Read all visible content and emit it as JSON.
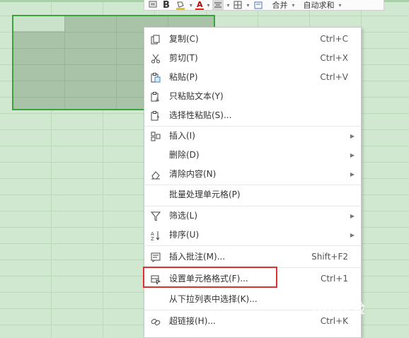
{
  "toolbar": {
    "bold": "B",
    "font_color": "A",
    "merge": "合并",
    "autosum": "自动求和",
    "highlight_color": "#e8c21a",
    "font_color_hex": "#e21e1e"
  },
  "menu": {
    "items": [
      {
        "label": "复制(C)",
        "shortcut": "Ctrl+C",
        "icon": "copy-icon"
      },
      {
        "label": "剪切(T)",
        "shortcut": "Ctrl+X",
        "icon": "scissors-icon"
      },
      {
        "label": "粘贴(P)",
        "shortcut": "Ctrl+V",
        "icon": "paste-icon"
      },
      {
        "label": "只粘贴文本(Y)",
        "icon": "paste-text-icon"
      },
      {
        "label": "选择性粘贴(S)...",
        "icon": "paste-special-icon"
      },
      {
        "label": "插入(I)",
        "icon": "insert-icon",
        "submenu": true
      },
      {
        "label": "删除(D)",
        "submenu": true
      },
      {
        "label": "清除内容(N)",
        "icon": "eraser-icon",
        "submenu": true
      },
      {
        "label": "批量处理单元格(P)"
      },
      {
        "label": "筛选(L)",
        "icon": "filter-icon",
        "submenu": true
      },
      {
        "label": "排序(U)",
        "icon": "sort-icon",
        "submenu": true
      },
      {
        "label": "插入批注(M)...",
        "shortcut": "Shift+F2",
        "icon": "comment-icon"
      },
      {
        "label": "设置单元格格式(F)...",
        "shortcut": "Ctrl+1",
        "icon": "format-cells-icon",
        "highlighted": true
      },
      {
        "label": "从下拉列表中选择(K)..."
      },
      {
        "label": "超链接(H)...",
        "shortcut": "Ctrl+K",
        "icon": "link-icon"
      }
    ]
  },
  "watermark": {
    "text": "Bai经验"
  },
  "colors": {
    "highlight_box": "#e03030",
    "selection_border": "#3ea33e",
    "sheet_bg": "#cfe8cf"
  }
}
